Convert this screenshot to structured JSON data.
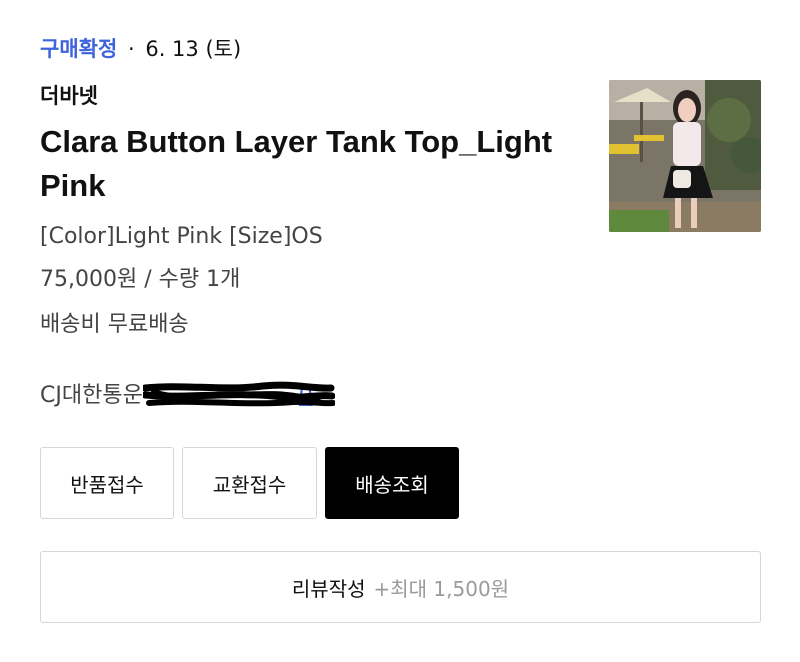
{
  "order": {
    "status": "구매확정",
    "separator": "·",
    "date": "6. 13 (토)"
  },
  "product": {
    "brand": "더바넷",
    "title": "Clara Button Layer Tank Top_Light Pink",
    "option": "[Color]Light Pink [Size]OS",
    "price_quantity": "75,000원 / 수량 1개",
    "shipping": "배송비 무료배송",
    "thumbnail_icon": "product-photo"
  },
  "delivery": {
    "courier": "CJ대한통운",
    "tracking_visible_suffix": "0",
    "tracking_redacted": true
  },
  "actions": {
    "return_label": "반품접수",
    "exchange_label": "교환접수",
    "track_label": "배송조회",
    "review_label": "리뷰작성",
    "review_reward": "+최대 1,500원"
  },
  "colors": {
    "status_blue": "#3d63dc",
    "primary_button": "#000000",
    "border": "#d6d6d6"
  }
}
